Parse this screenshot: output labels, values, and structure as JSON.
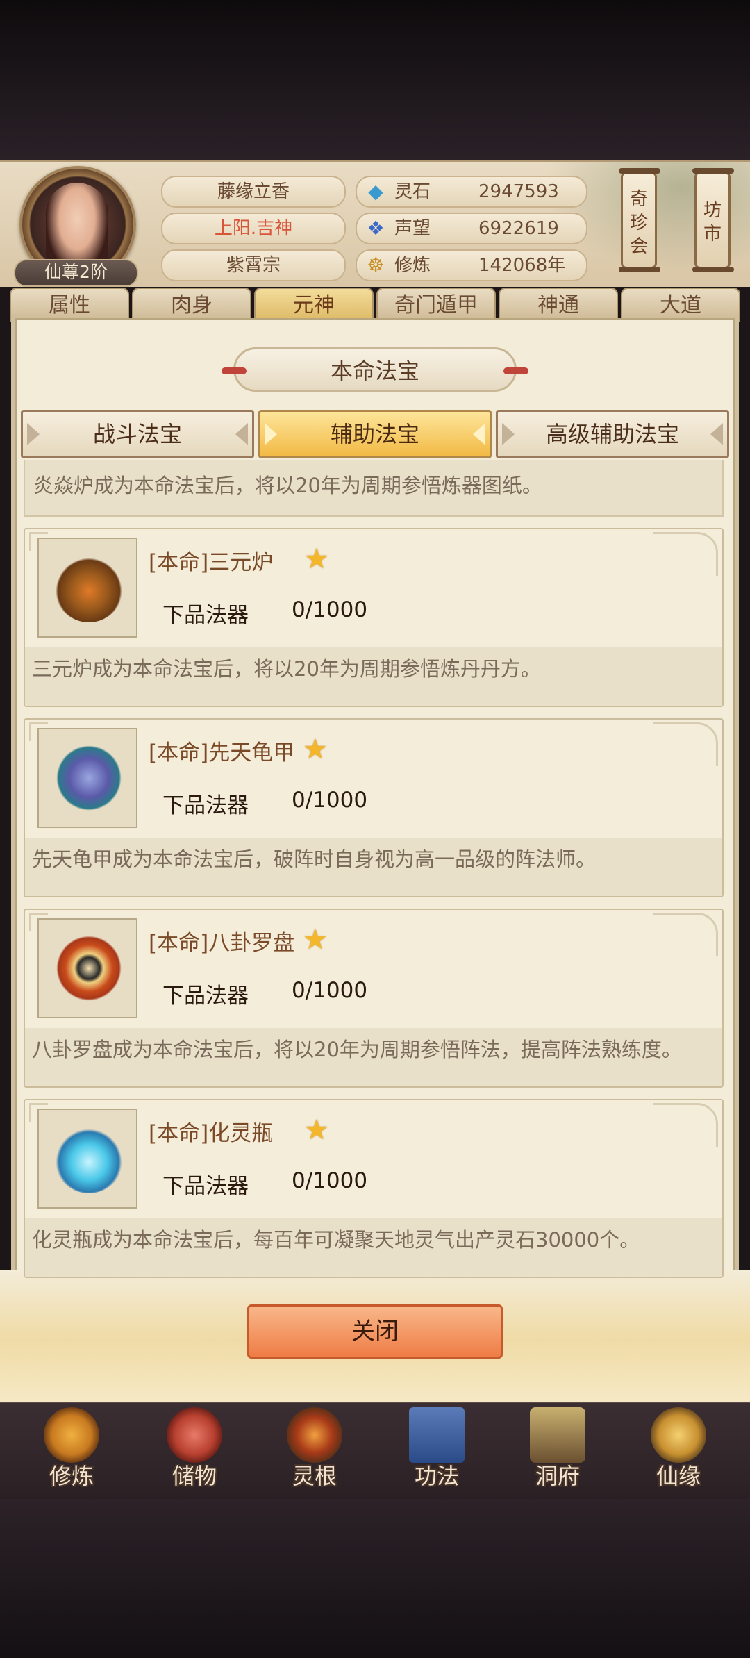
{
  "player": {
    "name": "藤缘立香",
    "location": "上阳.吉神",
    "sect": "紫霄宗",
    "rank": "仙尊2阶"
  },
  "stats": [
    {
      "icon": "spirit-stone-icon",
      "label": "灵石",
      "value": "2947593"
    },
    {
      "icon": "reputation-icon",
      "label": "声望",
      "value": "6922619"
    },
    {
      "icon": "cultivation-icon",
      "label": "修炼",
      "value": "142068年"
    }
  ],
  "side_buttons": {
    "treasure_fair": "奇珍会",
    "market": "坊市"
  },
  "section_tabs": [
    "属性",
    "肉身",
    "元神",
    "奇门遁甲",
    "神通",
    "大道"
  ],
  "active_section_tab": "元神",
  "panel": {
    "title": "本命法宝",
    "subtabs": [
      "战斗法宝",
      "辅助法宝",
      "高级辅助法宝"
    ],
    "active_subtab": "辅助法宝",
    "first_desc": "炎焱炉成为本命法宝后，将以20年为周期参悟炼器图纸。",
    "items": [
      {
        "name": "[本命]三元炉",
        "icon": "three-element-furnace-icon",
        "grade": "下品法器",
        "count": "0/1000",
        "desc": "三元炉成为本命法宝后，将以20年为周期参悟炼丹丹方。"
      },
      {
        "name": "[本命]先天龟甲",
        "icon": "turtle-shell-icon",
        "grade": "下品法器",
        "count": "0/1000",
        "desc": "先天龟甲成为本命法宝后，破阵时自身视为高一品级的阵法师。"
      },
      {
        "name": "[本命]八卦罗盘",
        "icon": "bagua-compass-icon",
        "grade": "下品法器",
        "count": "0/1000",
        "desc": "八卦罗盘成为本命法宝后，将以20年为周期参悟阵法，提高阵法熟练度。"
      },
      {
        "name": "[本命]化灵瓶",
        "icon": "spirit-bottle-icon",
        "grade": "下品法器",
        "count": "0/1000",
        "desc": "化灵瓶成为本命法宝后，每百年可凝聚天地灵气出产灵石30000个。"
      }
    ],
    "close_label": "关闭"
  },
  "bottom_nav": [
    "修炼",
    "储物",
    "灵根",
    "功法",
    "洞府",
    "仙缘"
  ]
}
